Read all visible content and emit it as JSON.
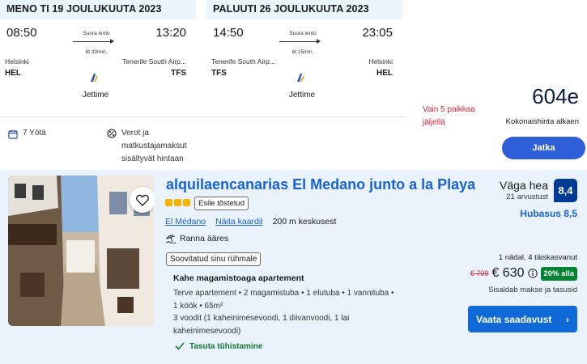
{
  "outbound": {
    "header": "MENO TI 19 JOULUKUUTA 2023",
    "dep_time": "08:50",
    "arr_time": "13:20",
    "stop_label": "Suora lento",
    "duration": "6t 30min.",
    "dep_city": "Helsinki",
    "arr_city": "Tenerife South Airp...",
    "dep_code": "HEL",
    "arr_code": "TFS",
    "airline": "Jettime"
  },
  "return": {
    "header": "PALUUTI 26 JOULUKUUTA 2023",
    "dep_time": "14:50",
    "arr_time": "23:05",
    "stop_label": "Suora lento",
    "duration": "6t 15min.",
    "dep_city": "Tenerife South Airp...",
    "arr_city": "Helsinki",
    "dep_code": "TFS",
    "arr_code": "HEL",
    "airline": "Jettime"
  },
  "features": {
    "nights": "7 Yötä",
    "taxes_line1": "Verot ja",
    "taxes_line2": "matkustajamaksut",
    "taxes_line3": "sisältyvät hintaan"
  },
  "offer": {
    "seats_line1": "Vain 5 paikkaa",
    "seats_line2": "jäljellä",
    "price": "604e",
    "price_label": "Kokonaishinta alkaen",
    "continue_label": "Jatka"
  },
  "hotel": {
    "name": "alquilaencanarias El Medano junto a la Playa",
    "promoted": "Esile tõstetud",
    "location": "El Médano",
    "map_link": "Näita kaardil",
    "distance": "200 m keskusest",
    "beach": "Ranna ääres",
    "group_badge": "Soovitatud sinu rühmale",
    "apartment_type": "Kahe magamistoaga apartement",
    "apartment_desc_1": "Terve apartement • 2 magamistuba • 1 elutuba • 1 vannituba •",
    "apartment_desc_2": "1 köök • 65m²",
    "apartment_desc_3": "3 voodit (1 kaheinimesevoodi, 1 diivanvoodi, 1 lai",
    "apartment_desc_4": "kaheinimesevoodi)",
    "cancellation": "Tasuta tühistamine",
    "review_word": "Väga hea",
    "review_count": "21 arvustust",
    "score": "8,4",
    "subscore": "Hubasus 8,5",
    "stay": "1 nädal, 4 täiskasvanut",
    "old_price": "€ 709",
    "new_price": "€ 630",
    "discount": "20% alla",
    "includes": "Sisaldab makse ja tasusid",
    "availability_label": "Vaata saadavust"
  },
  "colors": {
    "accent_blue": "#1862d6",
    "continue_button": "#2e5fd9",
    "score_badge": "#003b95",
    "discount_green": "#008234",
    "warning_red": "#d7263d"
  }
}
